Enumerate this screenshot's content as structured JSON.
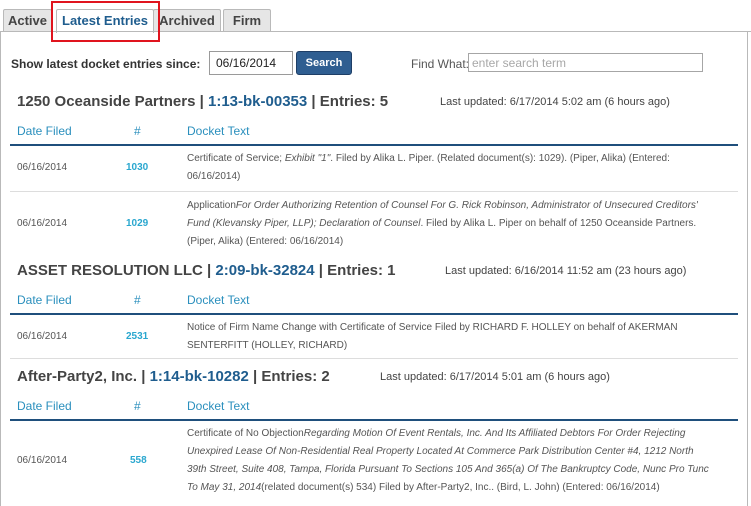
{
  "tabs": [
    {
      "label": "Active"
    },
    {
      "label": "Latest Entries"
    },
    {
      "label": "Archived"
    },
    {
      "label": "Firm"
    }
  ],
  "search": {
    "label": "Show latest docket entries since:",
    "date_value": "06/16/2014",
    "button_label": "Search",
    "find_label": "Find What:",
    "term_placeholder": "enter search term"
  },
  "columns": {
    "date": "Date Filed",
    "num": "#",
    "text": "Docket Text"
  },
  "cases": [
    {
      "name": "1250 Oceanside Partners",
      "case_number": "1:13-bk-00353",
      "entries_label": "Entries: 5",
      "last_updated": "Last updated: 6/17/2014 5:02 am (6 hours ago)",
      "entries": [
        {
          "date": "06/16/2014",
          "num": "1030",
          "line1_a": "Certificate of Service; ",
          "line1_i": "Exhibit \"1\"",
          "line1_b": ". Filed by Alika L. Piper. (Related document(s): 1029). (Piper, Alika) (Entered:",
          "line2": "06/16/2014)"
        },
        {
          "date": "06/16/2014",
          "num": "1029",
          "line1_a": "Application",
          "line1_i": "For Order Authorizing Retention of Counsel For G. Rick Robinson, Administrator of Unsecured Creditors'",
          "line2_i": "Fund (Klevansky Piper, LLP); Declaration of Counsel",
          "line2_b": ". Filed by Alika L. Piper on behalf of 1250 Oceanside Partners.",
          "line3": "(Piper, Alika) (Entered: 06/16/2014)"
        }
      ]
    },
    {
      "name": "ASSET RESOLUTION LLC",
      "case_number": "2:09-bk-32824",
      "entries_label": "Entries: 1",
      "last_updated": "Last updated: 6/16/2014 11:52 am (23 hours ago)",
      "entries": [
        {
          "date": "06/16/2014",
          "num": "2531",
          "line1": "Notice of Firm Name Change with Certificate of Service Filed by RICHARD F. HOLLEY on behalf of AKERMAN",
          "line2": "SENTERFITT (HOLLEY, RICHARD)"
        }
      ]
    },
    {
      "name": "After-Party2, Inc.",
      "case_number": "1:14-bk-10282",
      "entries_label": "Entries: 2",
      "last_updated": "Last updated: 6/17/2014 5:01 am (6 hours ago)",
      "entries": [
        {
          "date": "06/16/2014",
          "num": "558",
          "line1_a": "Certificate of No Objection",
          "line1_i": "Regarding Motion Of Event Rentals, Inc. And Its Affiliated Debtors For Order Rejecting",
          "line2_i": "Unexpired Lease Of Non-Residential Real Property Located At Commerce Park Distribution Center #4, 1212 North",
          "line3_i": "39th Street, Suite 408, Tampa, Florida Pursuant To Sections 105 And 365(a) Of The Bankruptcy Code, Nunc Pro Tunc",
          "line4_i": "To May 31, 2014",
          "line4_b": "(related document(s) 534) Filed by After-Party2, Inc.. (Bird, L. John) (Entered: 06/16/2014)"
        }
      ]
    }
  ],
  "separators": {
    "pipe": " | "
  }
}
